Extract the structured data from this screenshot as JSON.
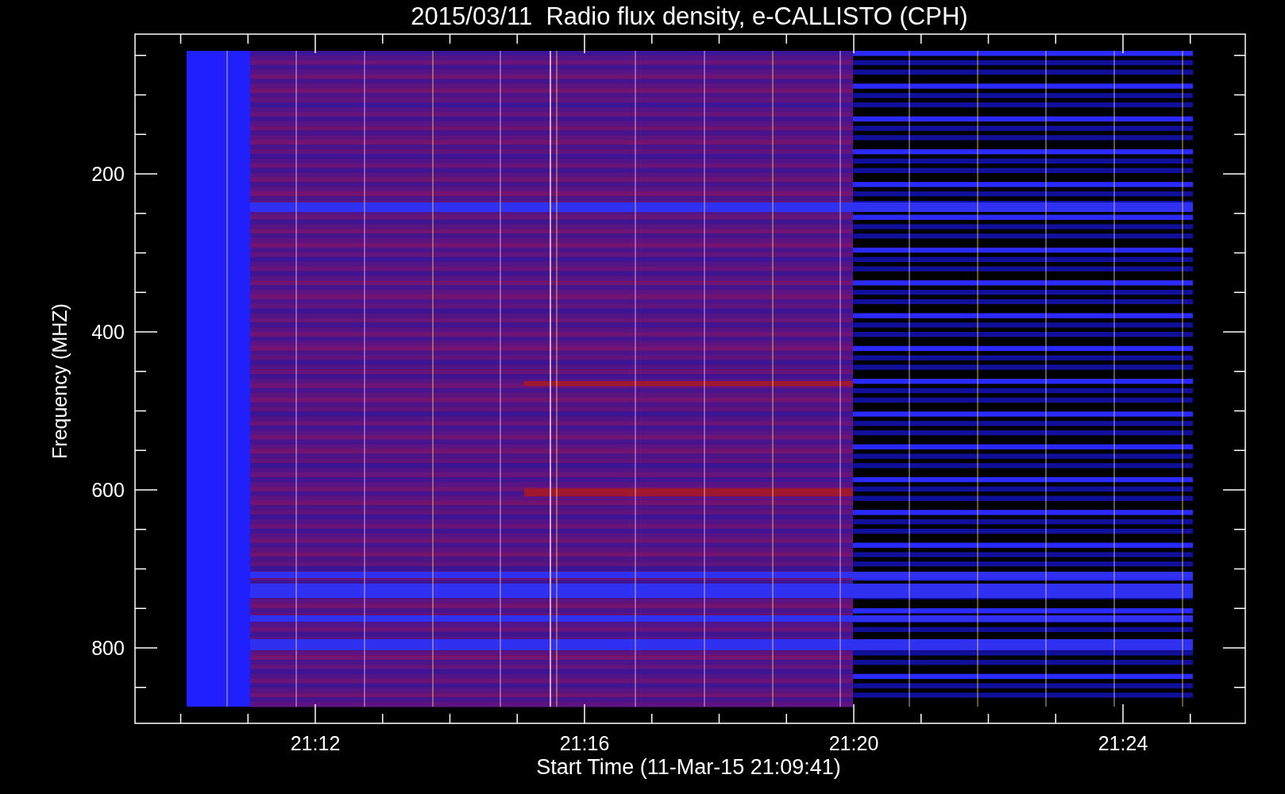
{
  "title": "2015/03/11  Radio flux density, e-CALLISTO (CPH)",
  "y_axis": {
    "label": "Frequency (MHZ)",
    "tick_labels": [
      "200",
      "400",
      "600",
      "800"
    ]
  },
  "x_axis": {
    "label": "Start Time (11-Mar-15 21:09:41)",
    "tick_labels": [
      "21:12",
      "21:16",
      "21:20",
      "21:24"
    ]
  }
}
